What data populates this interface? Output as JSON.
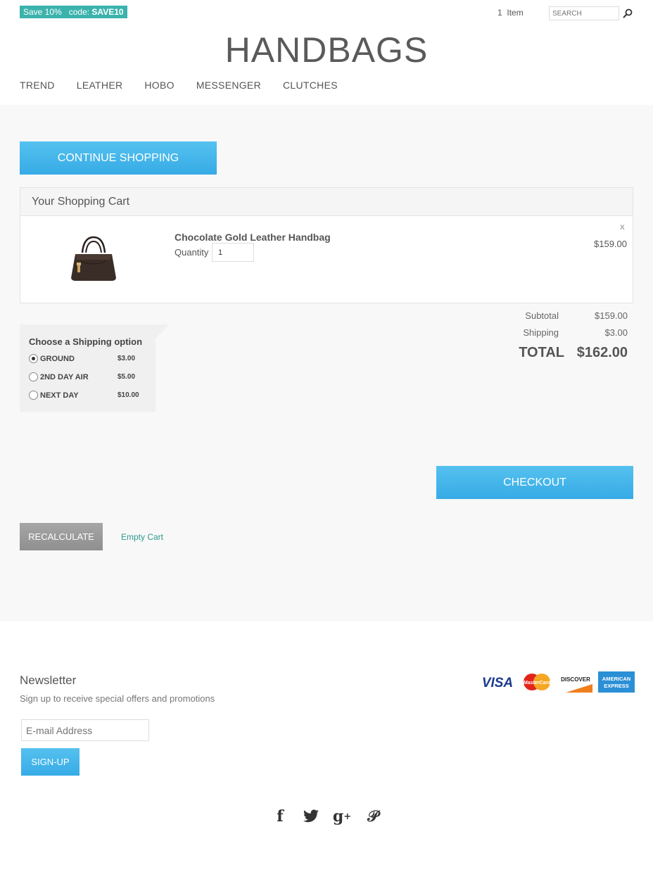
{
  "promo": {
    "label": "Save 10%",
    "code_prefix": "code:",
    "code": "SAVE10"
  },
  "header": {
    "cart_count": "1",
    "cart_label": "Item",
    "search_placeholder": "SEARCH",
    "logo": "HANDBAGS"
  },
  "nav": [
    "TREND",
    "LEATHER",
    "HOBO",
    "MESSENGER",
    "CLUTCHES"
  ],
  "buttons": {
    "continue": "CONTINUE SHOPPING",
    "checkout": "CHECKOUT",
    "recalculate": "RECALCULATE",
    "empty_cart": "Empty Cart"
  },
  "cart": {
    "title": "Your Shopping Cart",
    "item": {
      "name": "Chocolate Gold Leather Handbag",
      "quantity_label": "Quantity",
      "quantity": "1",
      "remove": "x",
      "price": "$159.00"
    }
  },
  "totals": {
    "subtotal_label": "Subtotal",
    "subtotal": "$159.00",
    "shipping_label": "Shipping",
    "shipping": "$3.00",
    "total_label": "TOTAL",
    "total": "$162.00"
  },
  "shipping": {
    "title": "Choose a Shipping option",
    "options": [
      {
        "name": "GROUND",
        "price": "$3.00",
        "selected": true
      },
      {
        "name": "2ND DAY AIR",
        "price": "$5.00",
        "selected": false
      },
      {
        "name": "NEXT DAY",
        "price": "$10.00",
        "selected": false
      }
    ]
  },
  "newsletter": {
    "title": "Newsletter",
    "subtitle": "Sign up to receive special offers and promotions",
    "email_placeholder": "E-mail Address",
    "signup": "SIGN-UP"
  },
  "payment_cards": [
    "VISA",
    "MasterCard",
    "DISCOVER",
    "AMERICAN EXPRESS"
  ],
  "social": [
    "facebook-icon",
    "twitter-icon",
    "google-plus-icon",
    "pinterest-icon"
  ],
  "colors": {
    "accent": "#3bb3ac",
    "button_blue": "#41b4ea",
    "link": "#2b9a8c"
  }
}
